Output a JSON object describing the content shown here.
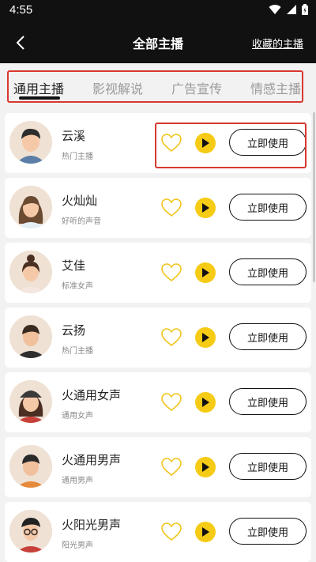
{
  "status_bar": {
    "time": "4:55"
  },
  "header": {
    "title": "全部主播",
    "favorites_link": "收藏的主播"
  },
  "tabs": [
    {
      "label": "通用主播",
      "active": true
    },
    {
      "label": "影视解说",
      "active": false
    },
    {
      "label": "广告宣传",
      "active": false
    },
    {
      "label": "情感主播",
      "active": false
    }
  ],
  "anchors": [
    {
      "name": "云溪",
      "desc": "热门主播",
      "button": "立即使用"
    },
    {
      "name": "火灿灿",
      "desc": "好听的声音",
      "button": "立即使用"
    },
    {
      "name": "艾佳",
      "desc": "标准女声",
      "button": "立即使用"
    },
    {
      "name": "云扬",
      "desc": "热门主播",
      "button": "立即使用"
    },
    {
      "name": "火通用女声",
      "desc": "通用女声",
      "button": "立即使用"
    },
    {
      "name": "火通用男声",
      "desc": "通用男声",
      "button": "立即使用"
    },
    {
      "name": "火阳光男声",
      "desc": "阳光男声",
      "button": "立即使用"
    }
  ],
  "colors": {
    "accent": "#f6cb15",
    "header_bg": "#111111",
    "highlight": "#d9382f"
  }
}
